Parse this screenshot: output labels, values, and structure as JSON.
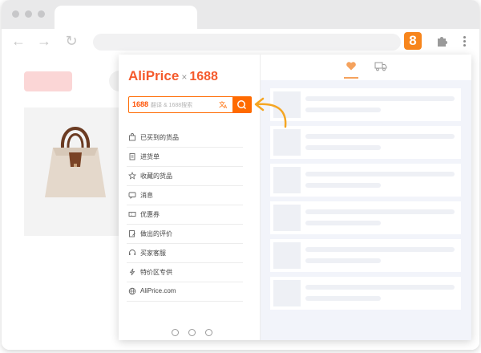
{
  "extension": {
    "badge": "8"
  },
  "popup": {
    "logo": {
      "brand": "AliPrice",
      "separator": "×",
      "partner": "1688"
    },
    "search": {
      "prefix": "1688",
      "placeholder": "翻译 & 1688搜索"
    },
    "menu": [
      {
        "label": "已买到的货品",
        "icon": "shopping-bag-icon"
      },
      {
        "label": "进货单",
        "icon": "clipboard-icon"
      },
      {
        "label": "收藏的货品",
        "icon": "star-icon"
      },
      {
        "label": "消息",
        "icon": "message-icon"
      },
      {
        "label": "优惠券",
        "icon": "coupon-icon"
      },
      {
        "label": "做出的评价",
        "icon": "review-icon"
      },
      {
        "label": "买家客服",
        "icon": "customer-service-icon"
      },
      {
        "label": "特价区专供",
        "icon": "lightning-icon"
      },
      {
        "label": "AliPrice.com",
        "icon": "globe-icon"
      }
    ],
    "footer_icons": [
      "settings-icon",
      "help-icon",
      "chat-icon"
    ]
  },
  "colors": {
    "accent": "#ff6a00",
    "brand": "#f55a2c",
    "extension_badge": "#f7851c",
    "heart": "#f5a25d",
    "skeleton_bg": "#f2f4fa"
  }
}
